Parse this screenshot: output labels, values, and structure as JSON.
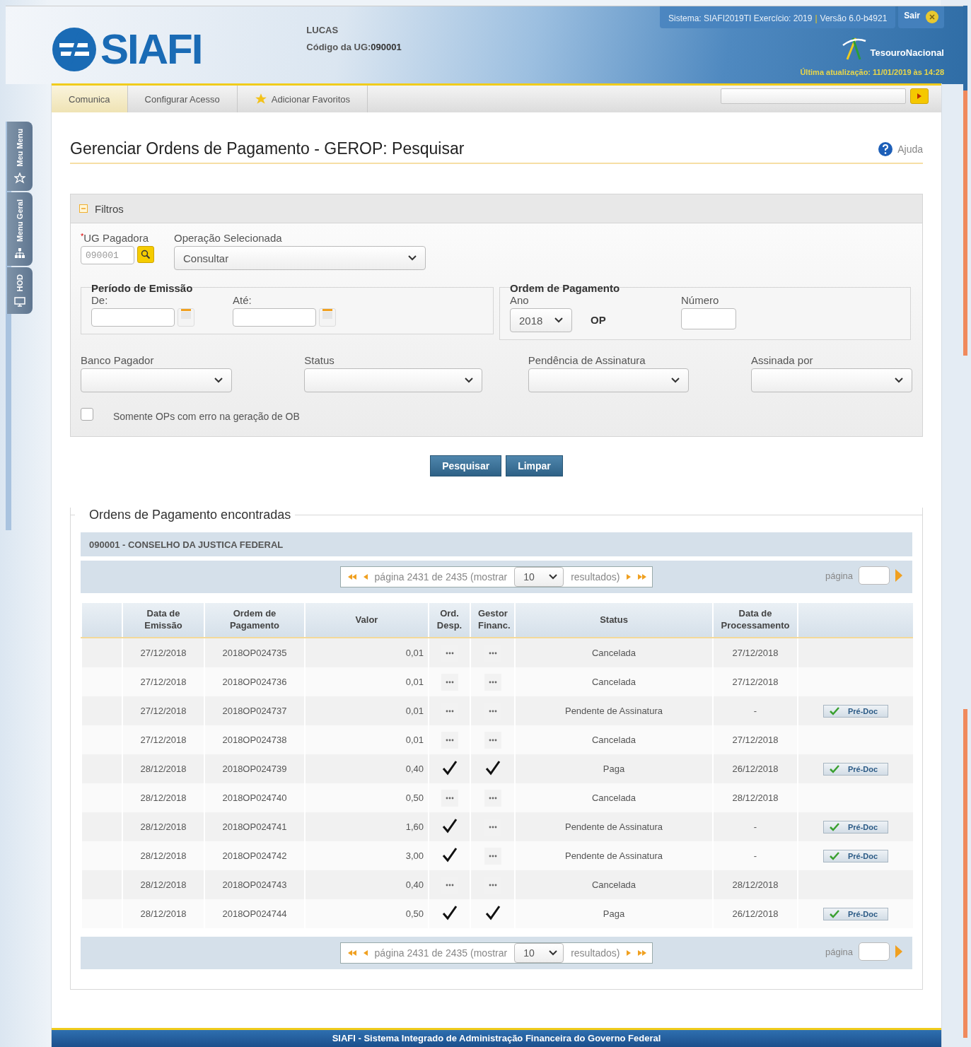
{
  "header": {
    "logo": "SIAFI",
    "user": "LUCAS",
    "ug_label": "Código da UG:",
    "ug_code": "090001",
    "system_info": "Sistema: SIAFI2019TI Exercício: 2019",
    "separator": "|",
    "version": "Versão 6.0-b4921",
    "logout": "Sair",
    "brand": "TesouroNacional",
    "last_update": "Última atualização: 11/01/2019 às 14:28"
  },
  "side_tabs": [
    {
      "label": "Meu Menu",
      "kind": "star"
    },
    {
      "label": "Menu Geral",
      "kind": "tree"
    },
    {
      "label": "HOD",
      "kind": "monitor"
    }
  ],
  "menu": [
    {
      "label": "Comunica",
      "selected": true,
      "kind": "plain"
    },
    {
      "label": "Configurar Acesso",
      "selected": false,
      "kind": "plain"
    },
    {
      "label": "Adicionar Favoritos",
      "selected": false,
      "kind": "star"
    }
  ],
  "page": {
    "title": "Gerenciar Ordens de Pagamento - GEROP: Pesquisar",
    "help": "Ajuda"
  },
  "filters": {
    "title": "Filtros",
    "expanded": true,
    "required_mark": "*",
    "ug_label": "UG Pagadora",
    "ug_value": "090001",
    "operation_label": "Operação Selecionada",
    "operation_value": "Consultar",
    "period": {
      "legend": "Período de Emissão",
      "from_label": "De:",
      "to_label": "Até:"
    },
    "order": {
      "legend": "Ordem de Pagamento",
      "year_label": "Ano",
      "year": "2018",
      "op": "OP",
      "number_label": "Número"
    },
    "selects": [
      {
        "label": "Banco Pagador"
      },
      {
        "label": "Status"
      },
      {
        "label": "Pendência de Assinatura"
      },
      {
        "label": "Assinada por"
      }
    ],
    "checkbox": {
      "label": "Somente OPs com erro na geração de OB",
      "checked": false
    }
  },
  "buttons": [
    "Pesquisar",
    "Limpar"
  ],
  "results": {
    "legend": "Ordens de Pagamento encontradas",
    "group": "090001 - CONSELHO DA JUSTICA FEDERAL",
    "pagers": [
      {
        "text": "página 2431 de 2435 (mostrar",
        "page_size": "10",
        "suffix": "resultados)",
        "goto_label": "página"
      },
      {
        "text": "página 2431 de 2435 (mostrar",
        "page_size": "10",
        "suffix": "resultados)",
        "goto_label": "página"
      }
    ],
    "columns": [
      "Data de Emissão",
      "Ordem de Pagamento",
      "Valor",
      "Ord. Desp.",
      "Gestor Financ.",
      "Status",
      "Data de Processamento"
    ],
    "rows": [
      {
        "date": "27/12/2018",
        "order": "2018OP024735",
        "value": "0,01",
        "ord_desp": false,
        "gestor": false,
        "status": "Cancelada",
        "processed": "27/12/2018"
      },
      {
        "date": "27/12/2018",
        "order": "2018OP024736",
        "value": "0,01",
        "ord_desp": false,
        "gestor": false,
        "status": "Cancelada",
        "processed": "27/12/2018"
      },
      {
        "date": "27/12/2018",
        "order": "2018OP024737",
        "value": "0,01",
        "ord_desp": false,
        "gestor": false,
        "status": "Pendente de Assinatura",
        "processed": "-",
        "action": "Pré-Doc"
      },
      {
        "date": "27/12/2018",
        "order": "2018OP024738",
        "value": "0,01",
        "ord_desp": false,
        "gestor": false,
        "status": "Cancelada",
        "processed": "27/12/2018"
      },
      {
        "date": "28/12/2018",
        "order": "2018OP024739",
        "value": "0,40",
        "ord_desp": true,
        "gestor": true,
        "status": "Paga",
        "processed": "26/12/2018",
        "action": "Pré-Doc"
      },
      {
        "date": "28/12/2018",
        "order": "2018OP024740",
        "value": "0,50",
        "ord_desp": false,
        "gestor": false,
        "status": "Cancelada",
        "processed": "28/12/2018"
      },
      {
        "date": "28/12/2018",
        "order": "2018OP024741",
        "value": "1,60",
        "ord_desp": true,
        "gestor": false,
        "status": "Pendente de Assinatura",
        "processed": "-",
        "action": "Pré-Doc"
      },
      {
        "date": "28/12/2018",
        "order": "2018OP024742",
        "value": "3,00",
        "ord_desp": true,
        "gestor": false,
        "status": "Pendente de Assinatura",
        "processed": "-",
        "action": "Pré-Doc"
      },
      {
        "date": "28/12/2018",
        "order": "2018OP024743",
        "value": "0,40",
        "ord_desp": false,
        "gestor": false,
        "status": "Cancelada",
        "processed": "28/12/2018"
      },
      {
        "date": "28/12/2018",
        "order": "2018OP024744",
        "value": "0,50",
        "ord_desp": true,
        "gestor": true,
        "status": "Paga",
        "processed": "26/12/2018",
        "action": "Pré-Doc"
      }
    ]
  },
  "footer": "SIAFI - Sistema Integrado de Administração Financeira do Governo Federal"
}
